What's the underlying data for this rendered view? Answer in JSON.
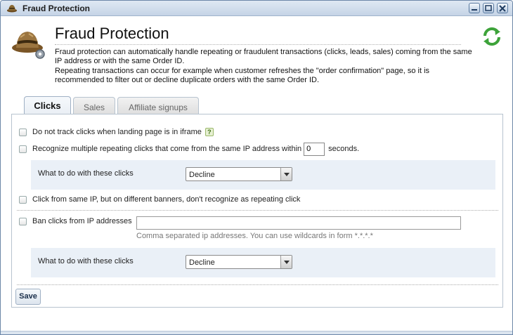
{
  "window": {
    "title": "Fraud Protection"
  },
  "header": {
    "title": "Fraud Protection",
    "description_1": "Fraud protection can automatically handle repeating or fraudulent transactions (clicks, leads, sales) coming from the same IP address or with the same Order ID.",
    "description_2": "Repeating transactions can occur for example when customer refreshes the \"order confirmation\" page, so it is recommended to filter out or decline duplicate orders with the same Order ID."
  },
  "tabs": [
    {
      "label": "Clicks",
      "active": true
    },
    {
      "label": "Sales",
      "active": false
    },
    {
      "label": "Affiliate signups",
      "active": false
    }
  ],
  "clicks": {
    "iframe_label": "Do not track clicks when landing page is in iframe",
    "repeat_label": "Recognize multiple repeating clicks that come from the same IP address within",
    "repeat_value": "0",
    "repeat_unit": "seconds.",
    "action1_label": "What to do with these clicks",
    "action1_value": "Decline",
    "banners_label": "Click from same IP, but on different banners, don't recognize as repeating click",
    "ban_label": "Ban clicks from IP addresses",
    "ban_value": "",
    "ban_hint": "Comma separated ip addresses. You can use wildcards in form *.*.*.*",
    "action2_label": "What to do with these clicks",
    "action2_value": "Decline"
  },
  "buttons": {
    "save": "Save"
  },
  "colors": {
    "accent": "#eaf0f7",
    "titlebar": "#c5d4e6"
  }
}
